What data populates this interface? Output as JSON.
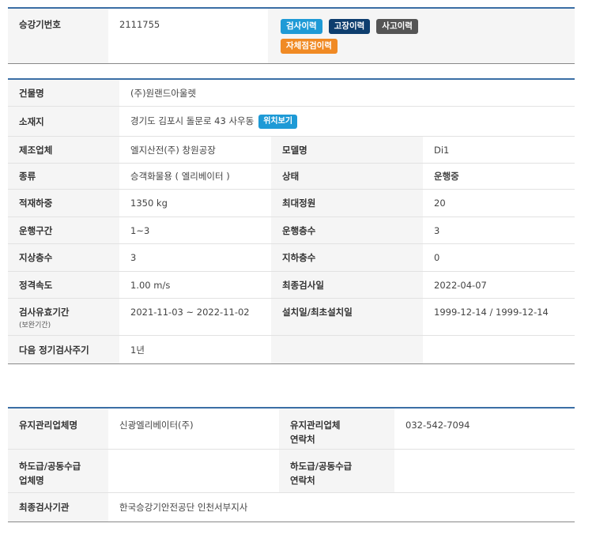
{
  "elevator": {
    "number_label": "승강기번호",
    "number_value": "2111755",
    "buttons": {
      "inspection": "검사이력",
      "failure": "고장이력",
      "accident": "사고이력",
      "self_check": "자체점검이력"
    },
    "colors": {
      "header_border": "#3a6ea5",
      "inspection_btn": "#1e9ad6",
      "failure_btn": "#0e3e6e",
      "accident_btn": "#555555",
      "self_check_btn": "#f08a24"
    }
  },
  "info": {
    "building_label": "건물명",
    "building_value": "(주)원랜드아울렛",
    "address_label": "소재지",
    "address_value": "경기도 김포시 돌문로 43 사우동",
    "location_button": "위치보기",
    "rows": [
      {
        "l1": "제조업체",
        "v1": "엘지산전(주) 창원공장",
        "l2": "모델명",
        "v2": "Di1"
      },
      {
        "l1": "종류",
        "v1": "승객화물용 ( 엘리베이터 )",
        "l2": "상태",
        "v2": "운행중"
      },
      {
        "l1": "적재하중",
        "v1": "1350 kg",
        "l2": "최대정원",
        "v2": "20"
      },
      {
        "l1": "운행구간",
        "v1": "1~3",
        "l2": "운행층수",
        "v2": "3"
      },
      {
        "l1": "지상층수",
        "v1": "3",
        "l2": "지하층수",
        "v2": "0"
      },
      {
        "l1": "정격속도",
        "v1": "1.00 m/s",
        "l2": "최종검사일",
        "v2": "2022-04-07"
      },
      {
        "l1": "검사유효기간",
        "l1_sub": "(보완기간)",
        "v1": "2021-11-03 ~ 2022-11-02",
        "l2": "설치일/최초설치일",
        "v2": "1999-12-14 / 1999-12-14"
      },
      {
        "l1": "다음 정기검사주기",
        "v1": "1년",
        "l2": "",
        "v2": ""
      }
    ]
  },
  "maintenance": {
    "company_label": "유지관리업체명",
    "company_value": "신광엘리베이터(주)",
    "contact_label": "유지관리업체\n연락처",
    "contact_value": "032-542-7094",
    "sub_label": "하도급/공동수급\n업체명",
    "sub_value": "",
    "sub_contact_label": "하도급/공동수급\n연락처",
    "sub_contact_value": "",
    "agency_label": "최종검사기관",
    "agency_value": "한국승강기안전공단 인천서부지사"
  }
}
